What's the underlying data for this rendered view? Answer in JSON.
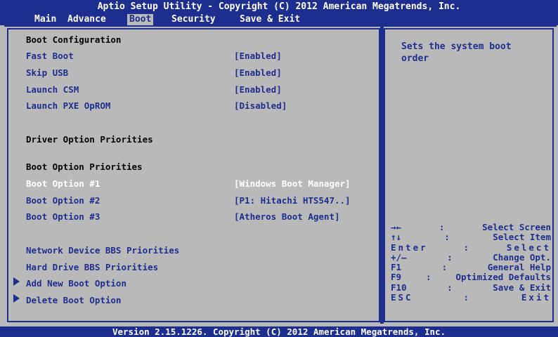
{
  "title": "Aptio Setup Utility - Copyright (C) 2012 American Megatrends, Inc.",
  "tabs": [
    "Main",
    "Advance",
    "Boot",
    "Security",
    "Save & Exit"
  ],
  "active_tab": "Boot",
  "sections": {
    "boot_configuration": "Boot Configuration",
    "driver_option_priorities": "Driver Option Priorities",
    "boot_option_priorities": "Boot Option Priorities"
  },
  "settings": {
    "fast_boot": {
      "label": "Fast Boot",
      "value": "[Enabled]"
    },
    "skip_usb": {
      "label": "Skip USB",
      "value": "[Enabled]"
    },
    "launch_csm": {
      "label": "Launch CSM",
      "value": "[Enabled]"
    },
    "launch_pxe": {
      "label": "Launch PXE OpROM",
      "value": "[Disabled]"
    },
    "boot_option_1": {
      "label": "Boot Option #1",
      "value": "[Windows Boot Manager]"
    },
    "boot_option_2": {
      "label": "Boot Option #2",
      "value": "[P1: Hitachi HTS547..]"
    },
    "boot_option_3": {
      "label": "Boot Option #3",
      "value": "[Atheros Boot Agent]"
    }
  },
  "links": {
    "network_bbs": "Network Device BBS Priorities",
    "hard_drive_bbs": "Hard Drive BBS Priorities",
    "add_boot_option": "Add New Boot Option",
    "delete_boot_option": "Delete Boot Option"
  },
  "help_text": "Sets the system boot\norder",
  "key_legend": [
    [
      "→←",
      ":",
      "Select Screen"
    ],
    [
      "↑↓",
      ":",
      "Select Item"
    ],
    [
      "Enter",
      ":",
      "Select"
    ],
    [
      "+/—",
      ":",
      "Change Opt."
    ],
    [
      "F1",
      ":",
      "General Help"
    ],
    [
      "F9",
      ":",
      "Optimized Defaults"
    ],
    [
      "F10",
      ":",
      "Save & Exit"
    ],
    [
      "ESC",
      ":",
      "Exit"
    ]
  ],
  "footer": "Version 2.15.1226. Copyright (C) 2012 American Megatrends, Inc.",
  "colors": {
    "accent_blue": "#1e2e8e",
    "background_gray": "#b9b9b9",
    "selected_text": "#ffffff"
  }
}
